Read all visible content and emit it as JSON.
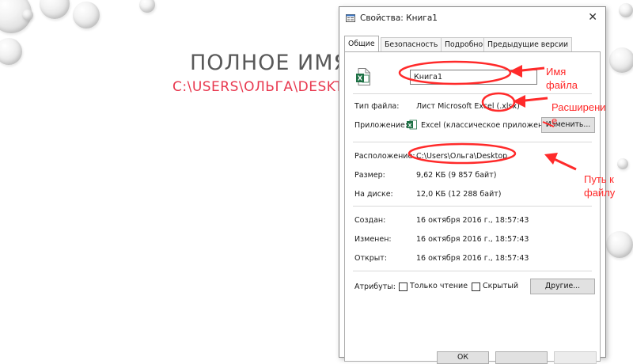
{
  "slide": {
    "title": "ПОЛНОЕ ИМЯ",
    "subtitle": "C:\\USERS\\ОЛЬГА\\DESKTO"
  },
  "dialog": {
    "title": "Свойства: Книга1",
    "tabs": [
      {
        "label": "Общие"
      },
      {
        "label": "Безопасность"
      },
      {
        "label": "Подробно"
      },
      {
        "label": "Предыдущие версии"
      }
    ],
    "file_name": "Книга1",
    "rows": {
      "file_type_label": "Тип файла:",
      "file_type_value": "Лист Microsoft Excel (.xlsx)",
      "app_label": "Приложение:",
      "app_value": "Excel (классическое приложени",
      "change_button": "Изменить...",
      "location_label": "Расположение:",
      "location_value": "C:\\Users\\Ольга\\Desktop",
      "size_label": "Размер:",
      "size_value": "9,62 КБ (9 857 байт)",
      "disk_label": "На диске:",
      "disk_value": "12,0 КБ (12 288 байт)",
      "created_label": "Создан:",
      "created_value": "16 октября 2016 г., 18:57:43",
      "modified_label": "Изменен:",
      "modified_value": "16 октября 2016 г., 18:57:43",
      "opened_label": "Открыт:",
      "opened_value": "16 октября 2016 г., 18:57:43",
      "attributes_label": "Атрибуты:",
      "readonly_label": "Только чтение",
      "hidden_label": "Скрытый",
      "other_button": "Другие..."
    },
    "footer_buttons": [
      "ОК"
    ]
  },
  "annotations": {
    "name_line1": "Имя",
    "name_line2": "файла",
    "ext_line1": "Расширени",
    "ext_line2": "е",
    "path_line1": "Путь к",
    "path_line2": "файлу"
  },
  "colors": {
    "annotation_red": "#ff2a2a",
    "subtitle_red": "#e8384f",
    "excel_green": "#1e7145"
  }
}
